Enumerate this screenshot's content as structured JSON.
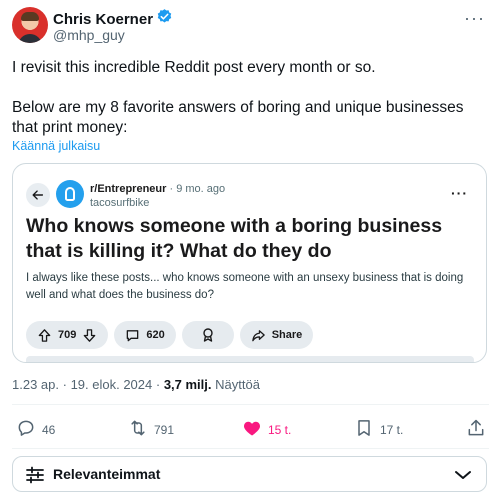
{
  "author": {
    "display_name": "Chris Koerner",
    "handle": "@mhp_guy",
    "verified": true,
    "avatar_icon": "avatar"
  },
  "tweet": {
    "line1": "I revisit this incredible Reddit post every month or so.",
    "line2": "Below are my 8 favorite answers of boring and unique businesses that print money:",
    "translate_link": "Käännä julkaisu",
    "more_icon": "more-horizontal-icon"
  },
  "reddit_card": {
    "subreddit": "r/Entrepreneur",
    "separator": "·",
    "age": "9 mo. ago",
    "author": "tacosurfbike",
    "title": "Who knows someone with a boring business that is killing it? What do they do",
    "body": "I always like these posts... who knows someone with an unsexy business that is doing well and what does the business do?",
    "upvotes": "709",
    "comments": "620",
    "share_label": "Share"
  },
  "meta": {
    "time": "1.23 ap.",
    "dot": " · ",
    "date": "19. elok. 2024",
    "views_count": "3,7 milj.",
    "views_label": " Näyttöä"
  },
  "stats": {
    "replies": "46",
    "retweets": "791",
    "likes": "15 t.",
    "bookmarks": "17 t."
  },
  "sort": {
    "label": "Relevanteimmat"
  },
  "colors": {
    "accent": "#1d9bf0",
    "like": "#f91880",
    "verified": "#1d9bf0"
  }
}
